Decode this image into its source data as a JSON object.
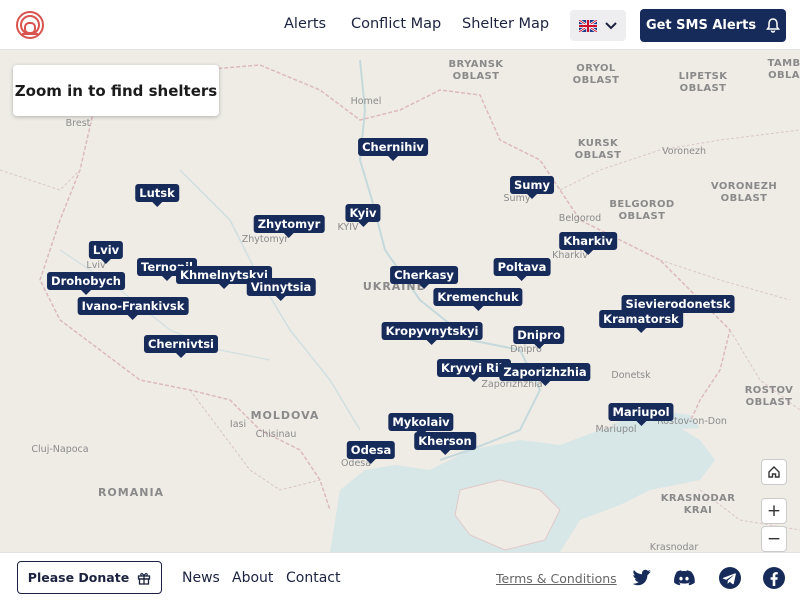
{
  "header": {
    "nav": [
      "Alerts",
      "Conflict Map",
      "Shelter Map"
    ],
    "sms_label": "Get SMS Alerts"
  },
  "map": {
    "zoom_hint": "Zoom in to find shelters",
    "pins": [
      "Chernihiv",
      "Sumy",
      "Lutsk",
      "Kyiv",
      "Zhytomyr",
      "Kharkiv",
      "Lviv",
      "Ternopil",
      "Khmelnytskyi",
      "Vinnytsia",
      "Drohobych",
      "Poltava",
      "Cherkasy",
      "Kremenchuk",
      "Ivano-Frankivsk",
      "Sievierodonetsk",
      "Kramatorsk",
      "Kropyvnytskyi",
      "Dnipro",
      "Chernivtsi",
      "Kryvyi Rih",
      "Zaporizhzhia",
      "Mariupol",
      "Mykolaiv",
      "Kherson",
      "Odesa"
    ],
    "places": [
      "Homel",
      "Brest",
      "Sumy",
      "Belgorod",
      "Voronezh",
      "Zhytomyr",
      "KYIV",
      "Lviv",
      "Kharkiv",
      "UKRAINE",
      "Dnipro",
      "Zaporizhzhia",
      "Donetsk",
      "Mariupol",
      "Rostov-on-Don",
      "Iasi",
      "Chisinau",
      "Cluj-Napoca",
      "Odesa",
      "Krasnodar",
      "MOLDOVA",
      "ROMANIA"
    ],
    "regions": [
      "BRYANSK\nOBLAST",
      "ORYOL\nOBLAST",
      "LIPETSK\nOBLAST",
      "TAMB\nOBLA",
      "KURSK\nOBLAST",
      "BELGOROD\nOBLAST",
      "VORONEZH\nOBLAST",
      "ROSTOV\nOBLAST",
      "KRASNODAR\nKRAI"
    ]
  },
  "footer": {
    "donate_label": "Please Donate",
    "links": [
      "News",
      "About",
      "Contact"
    ],
    "terms": "Terms & Conditions"
  },
  "colors": {
    "brand_navy": "#172b5a",
    "logo_red": "#d9534f",
    "map_land": "#efece6",
    "map_water": "#d7e6e6"
  },
  "icons": [
    "siren-logo-icon",
    "uk-flag-icon",
    "chevron-down-icon",
    "bell-icon",
    "gift-icon",
    "home-icon",
    "zoom-in-icon",
    "zoom-out-icon",
    "twitter-icon",
    "discord-icon",
    "telegram-icon",
    "facebook-icon"
  ]
}
